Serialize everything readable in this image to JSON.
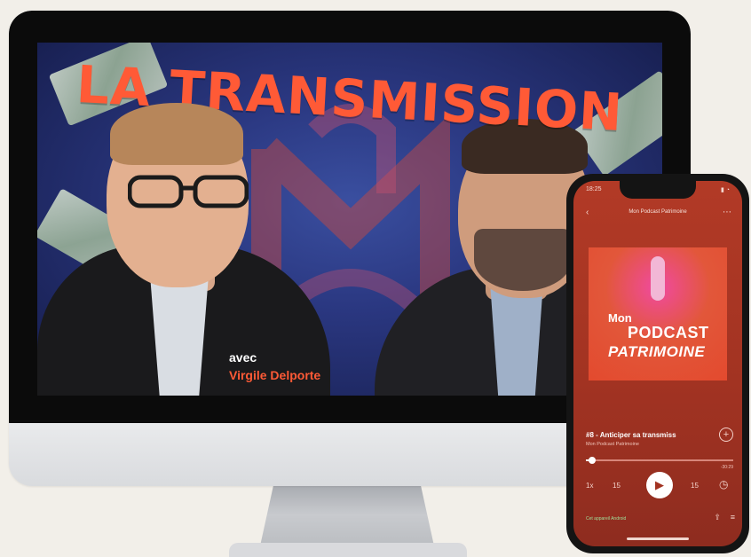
{
  "monitor": {
    "thumbnail": {
      "title": "LA TRANSMISSION",
      "caption_prefix": "avec",
      "guest_name": "Virgile Delporte"
    }
  },
  "phone": {
    "status": {
      "time": "18:25",
      "icons": "▮ ◔"
    },
    "nav": {
      "back_icon": "‹",
      "title": "Mon Podcast Patrimoine",
      "more_icon": "⋯"
    },
    "cover": {
      "line1": "Mon",
      "line2": "PODCAST",
      "line3": "PATRIMOINE"
    },
    "episode": {
      "title": "#8 - Anticiper sa transmiss",
      "show": "Mon Podcast Patrimoine",
      "progress": 0.03,
      "remaining": "-30:29"
    },
    "controls": {
      "speed": "1x",
      "rewind": "15",
      "play": "▶",
      "forward": "15",
      "timer": "◷"
    },
    "device": "Cet appareil Android",
    "colors": {
      "accent": "#ff5a36",
      "player_bg": "#a23322"
    }
  }
}
